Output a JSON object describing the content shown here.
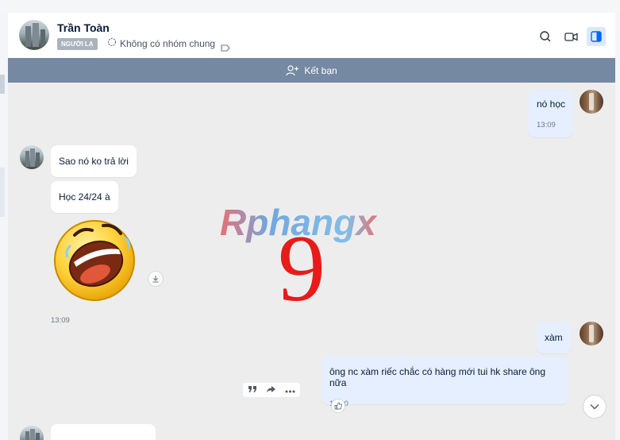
{
  "contact": {
    "name": "Trần Toàn",
    "badge": "NGƯỜI LẠ",
    "group_info": "Không có nhóm chung"
  },
  "header_icons": [
    "search-icon",
    "video-call-icon",
    "sidebar-toggle-icon"
  ],
  "friend_bar": {
    "label": "Kết bạn"
  },
  "messages": [
    {
      "id": "m1",
      "sender": "me",
      "text": "nó học",
      "time": "13:09"
    },
    {
      "id": "m2",
      "sender": "other",
      "text": "Sao nó ko trả lời"
    },
    {
      "id": "m3",
      "sender": "other",
      "text": "Học 24/24 à"
    },
    {
      "id": "m4",
      "sender": "other",
      "type": "sticker",
      "sticker": "laughing-face",
      "time": "13:09"
    },
    {
      "id": "m5",
      "sender": "me",
      "text": "xàm"
    },
    {
      "id": "m6",
      "sender": "me",
      "text": "ông nc xàm riếc chắc có hàng mới tui hk share ông nữa",
      "time": "13:10"
    }
  ],
  "watermark": {
    "text": "Rphangx",
    "number": "9"
  },
  "colors": {
    "friend_bar": "#7589a3",
    "my_bubble": "#e5efff",
    "accent": "#0068ff",
    "watermark_red": "#e81b1b"
  }
}
